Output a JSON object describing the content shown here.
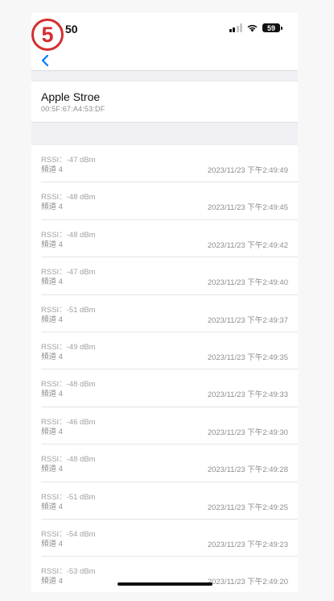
{
  "annotation": {
    "step": "5"
  },
  "status_bar": {
    "time": "50",
    "battery": "59",
    "icons": [
      "cellular-signal-icon",
      "wifi-icon",
      "battery-icon"
    ]
  },
  "nav": {
    "back_icon": "chevron-left-icon"
  },
  "device": {
    "name": "Apple Stroe",
    "mac": "00:5F:67:A4:53:DF"
  },
  "records": [
    {
      "rssi": "RSSI：-47 dBm",
      "channel": "頻道 4",
      "timestamp": "2023/11/23 下午2:49:49"
    },
    {
      "rssi": "RSSI：-48 dBm",
      "channel": "頻道 4",
      "timestamp": "2023/11/23 下午2:49:45"
    },
    {
      "rssi": "RSSI：-48 dBm",
      "channel": "頻道 4",
      "timestamp": "2023/11/23 下午2:49:42"
    },
    {
      "rssi": "RSSI：-47 dBm",
      "channel": "頻道 4",
      "timestamp": "2023/11/23 下午2:49:40"
    },
    {
      "rssi": "RSSI：-51 dBm",
      "channel": "頻道 4",
      "timestamp": "2023/11/23 下午2:49:37"
    },
    {
      "rssi": "RSSI：-49 dBm",
      "channel": "頻道 4",
      "timestamp": "2023/11/23 下午2:49:35"
    },
    {
      "rssi": "RSSI：-48 dBm",
      "channel": "頻道 4",
      "timestamp": "2023/11/23 下午2:49:33"
    },
    {
      "rssi": "RSSI：-46 dBm",
      "channel": "頻道 4",
      "timestamp": "2023/11/23 下午2:49:30"
    },
    {
      "rssi": "RSSI：-48 dBm",
      "channel": "頻道 4",
      "timestamp": "2023/11/23 下午2:49:28"
    },
    {
      "rssi": "RSSI：-51 dBm",
      "channel": "頻道 4",
      "timestamp": "2023/11/23 下午2:49:25"
    },
    {
      "rssi": "RSSI：-54 dBm",
      "channel": "頻道 4",
      "timestamp": "2023/11/23 下午2:49:23"
    },
    {
      "rssi": "RSSI：-53 dBm",
      "channel": "頻道 4",
      "timestamp": "2023/11/23 下午2:49:20"
    }
  ],
  "colors": {
    "accent": "#007aff",
    "annotation": "#d32f2f"
  }
}
